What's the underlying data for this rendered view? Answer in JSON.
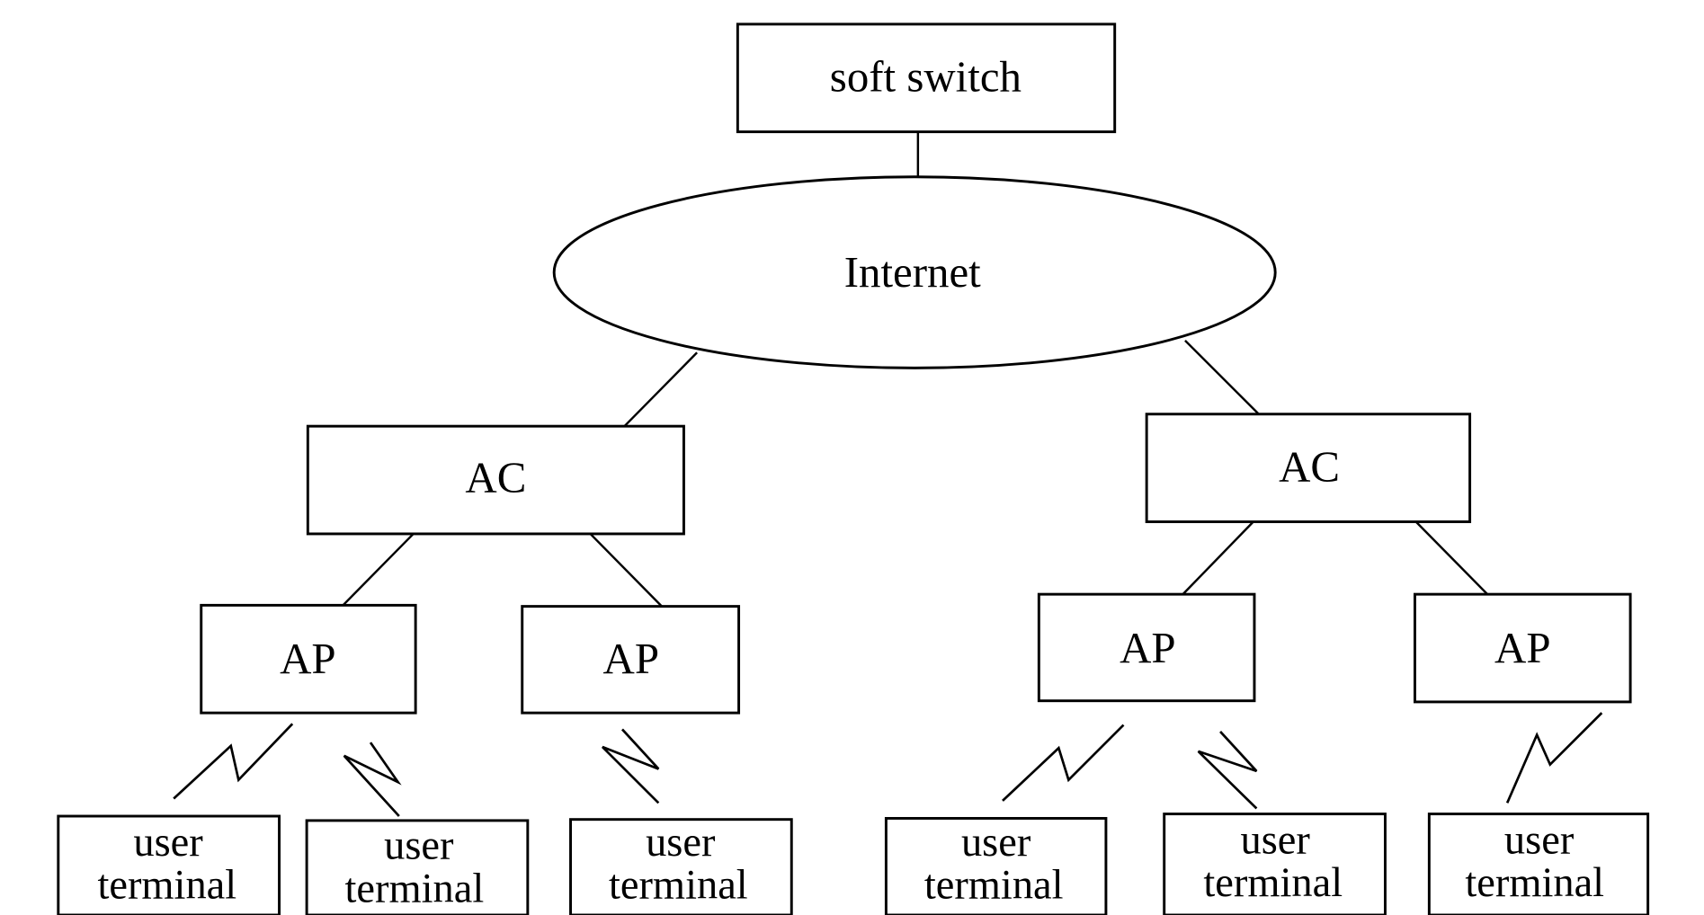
{
  "diagram": {
    "type": "network-topology",
    "nodes": [
      {
        "id": "softswitch",
        "label": "soft switch",
        "shape": "rectangle"
      },
      {
        "id": "internet",
        "label": "Internet",
        "shape": "ellipse"
      },
      {
        "id": "ac1",
        "label": "AC",
        "shape": "rectangle"
      },
      {
        "id": "ac2",
        "label": "AC",
        "shape": "rectangle"
      },
      {
        "id": "ap1",
        "label": "AP",
        "shape": "rectangle"
      },
      {
        "id": "ap2",
        "label": "AP",
        "shape": "rectangle"
      },
      {
        "id": "ap3",
        "label": "AP",
        "shape": "rectangle"
      },
      {
        "id": "ap4",
        "label": "AP",
        "shape": "rectangle"
      },
      {
        "id": "ut1",
        "label_line1": "user",
        "label_line2": "terminal",
        "shape": "rectangle"
      },
      {
        "id": "ut2",
        "label_line1": "user",
        "label_line2": "terminal",
        "shape": "rectangle"
      },
      {
        "id": "ut3",
        "label_line1": "user",
        "label_line2": "terminal",
        "shape": "rectangle"
      },
      {
        "id": "ut4",
        "label_line1": "user",
        "label_line2": "terminal",
        "shape": "rectangle"
      },
      {
        "id": "ut5",
        "label_line1": "user",
        "label_line2": "terminal",
        "shape": "rectangle"
      },
      {
        "id": "ut6",
        "label_line1": "user",
        "label_line2": "terminal",
        "shape": "rectangle"
      }
    ],
    "wired_links": [
      {
        "from": "softswitch",
        "to": "internet"
      },
      {
        "from": "internet",
        "to": "ac1"
      },
      {
        "from": "internet",
        "to": "ac2"
      },
      {
        "from": "ac1",
        "to": "ap1"
      },
      {
        "from": "ac1",
        "to": "ap2"
      },
      {
        "from": "ac2",
        "to": "ap3"
      },
      {
        "from": "ac2",
        "to": "ap4"
      }
    ],
    "wireless_links": [
      {
        "from": "ap1",
        "to": "ut1"
      },
      {
        "from": "ap1",
        "to": "ut2"
      },
      {
        "from": "ap2",
        "to": "ut3"
      },
      {
        "from": "ap3",
        "to": "ut4"
      },
      {
        "from": "ap3",
        "to": "ut5"
      },
      {
        "from": "ap4",
        "to": "ut6"
      }
    ]
  }
}
